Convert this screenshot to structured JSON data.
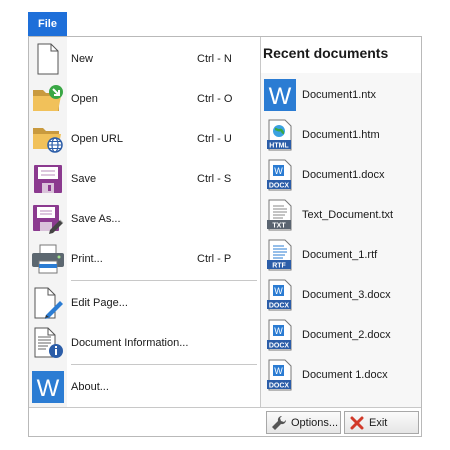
{
  "file_tab": {
    "label": "File"
  },
  "commands": [
    {
      "id": "new",
      "label": "New",
      "shortcut": "Ctrl - N",
      "icon": "new-document-icon"
    },
    {
      "id": "open",
      "label": "Open",
      "shortcut": "Ctrl - O",
      "icon": "open-folder-icon"
    },
    {
      "id": "open-url",
      "label": "Open URL",
      "shortcut": "Ctrl - U",
      "icon": "open-url-icon"
    },
    {
      "id": "save",
      "label": "Save",
      "shortcut": "Ctrl - S",
      "icon": "save-icon"
    },
    {
      "id": "save-as",
      "label": "Save As...",
      "shortcut": "",
      "icon": "save-as-icon"
    },
    {
      "id": "print",
      "label": "Print...",
      "shortcut": "Ctrl - P",
      "icon": "printer-icon"
    },
    {
      "id": "edit-page",
      "label": "Edit Page...",
      "shortcut": "",
      "icon": "edit-page-icon"
    },
    {
      "id": "document-information",
      "label": "Document Information...",
      "shortcut": "",
      "icon": "document-info-icon"
    },
    {
      "id": "about",
      "label": "About...",
      "shortcut": "",
      "icon": "word-app-icon"
    }
  ],
  "recent": {
    "title": "Recent documents",
    "items": [
      {
        "name": "Document1.ntx",
        "type_label": "",
        "icon": "word-app-icon"
      },
      {
        "name": "Document1.htm",
        "type_label": "HTML",
        "icon": "html-file-icon"
      },
      {
        "name": "Document1.docx",
        "type_label": "DOCX",
        "icon": "docx-file-icon"
      },
      {
        "name": "Text_Document.txt",
        "type_label": "TXT",
        "icon": "txt-file-icon"
      },
      {
        "name": "Document_1.rtf",
        "type_label": "RTF",
        "icon": "rtf-file-icon"
      },
      {
        "name": "Document_3.docx",
        "type_label": "DOCX",
        "icon": "docx-file-icon"
      },
      {
        "name": "Document_2.docx",
        "type_label": "DOCX",
        "icon": "docx-file-icon"
      },
      {
        "name": "Document 1.docx",
        "type_label": "DOCX",
        "icon": "docx-file-icon"
      }
    ]
  },
  "footer": {
    "options_label": "Options...",
    "exit_label": "Exit"
  },
  "colors": {
    "accent": "#1e6fd9",
    "word_blue": "#2b7cd3",
    "save_purple": "#8b3a8f",
    "exit_red": "#d23a2a"
  }
}
